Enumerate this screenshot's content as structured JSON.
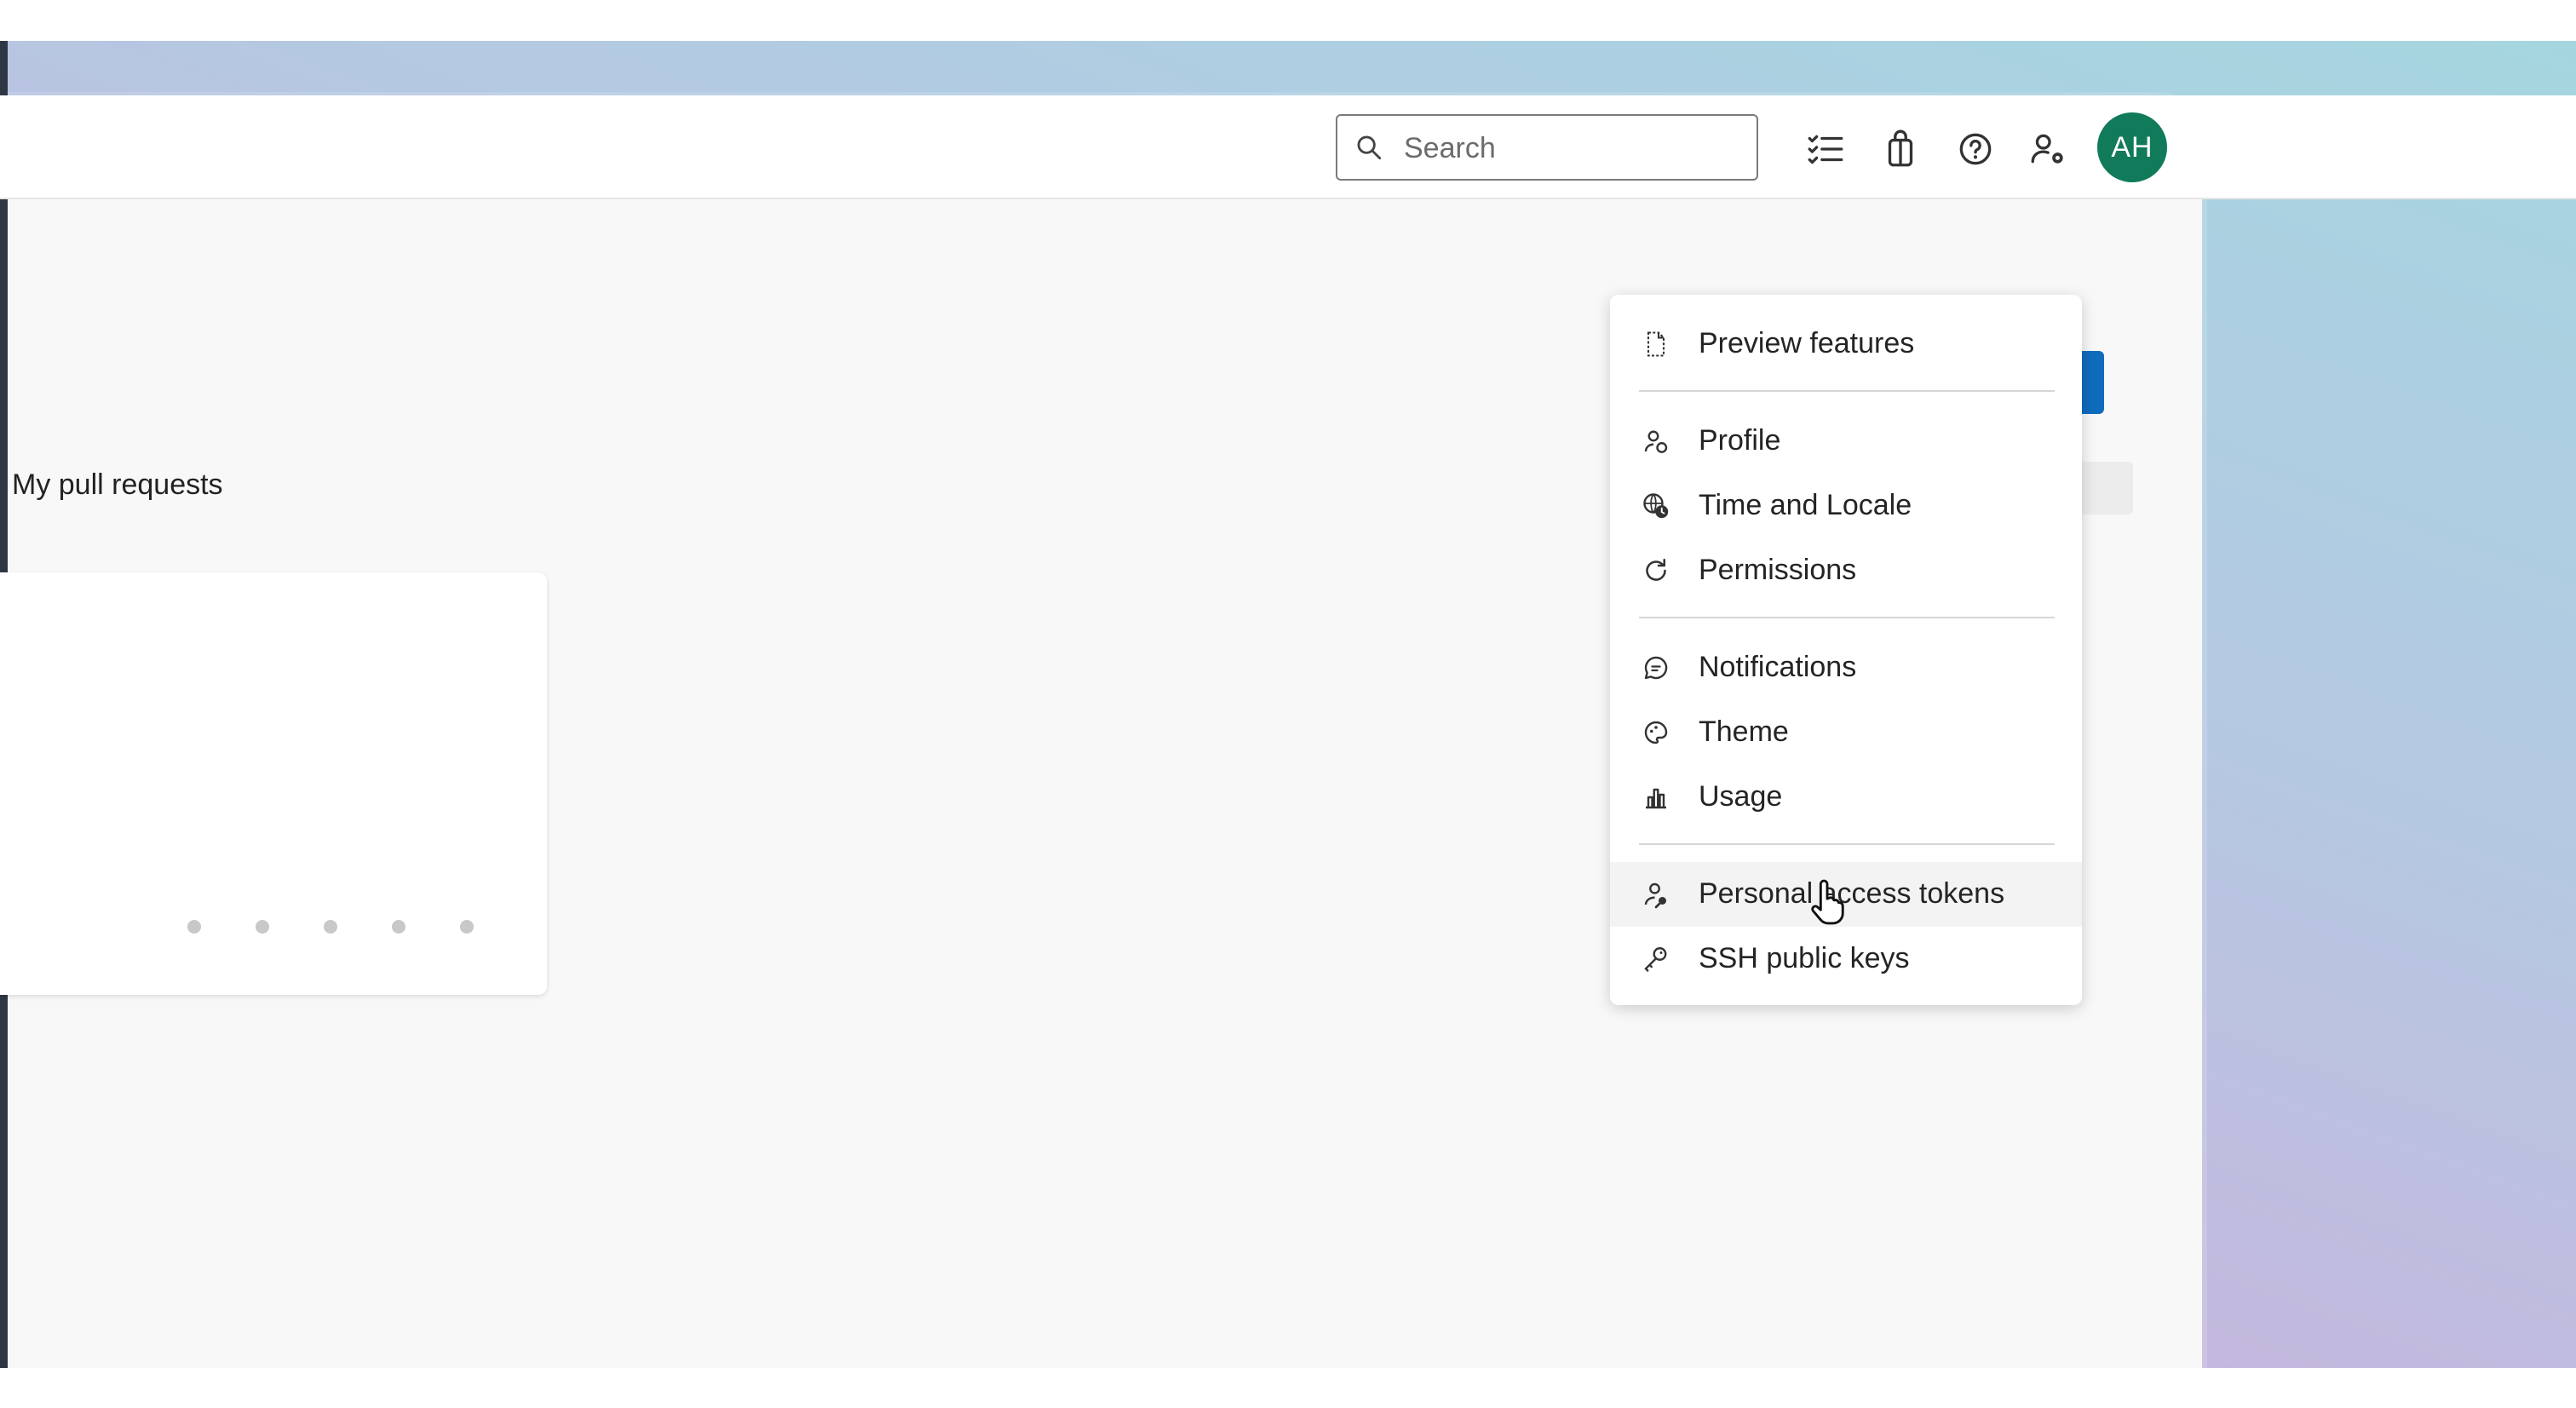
{
  "search": {
    "placeholder": "Search"
  },
  "avatar": {
    "initials": "AH",
    "color": "#117a5a"
  },
  "page": {
    "heading": "My pull requests"
  },
  "menu": {
    "items": [
      {
        "label": "Preview features",
        "icon": "preview-page-icon"
      },
      {
        "label": "Profile",
        "icon": "profile-icon"
      },
      {
        "label": "Time and Locale",
        "icon": "globe-clock-icon"
      },
      {
        "label": "Permissions",
        "icon": "refresh-permissions-icon"
      },
      {
        "label": "Notifications",
        "icon": "chat-bubble-icon"
      },
      {
        "label": "Theme",
        "icon": "palette-icon"
      },
      {
        "label": "Usage",
        "icon": "bar-chart-icon"
      },
      {
        "label": "Personal access tokens",
        "icon": "person-key-icon"
      },
      {
        "label": "SSH public keys",
        "icon": "key-icon"
      }
    ]
  },
  "colors": {
    "chrome": "#3b4658",
    "accent": "#0f6cbd",
    "extension_profile": "#1f9d62"
  }
}
